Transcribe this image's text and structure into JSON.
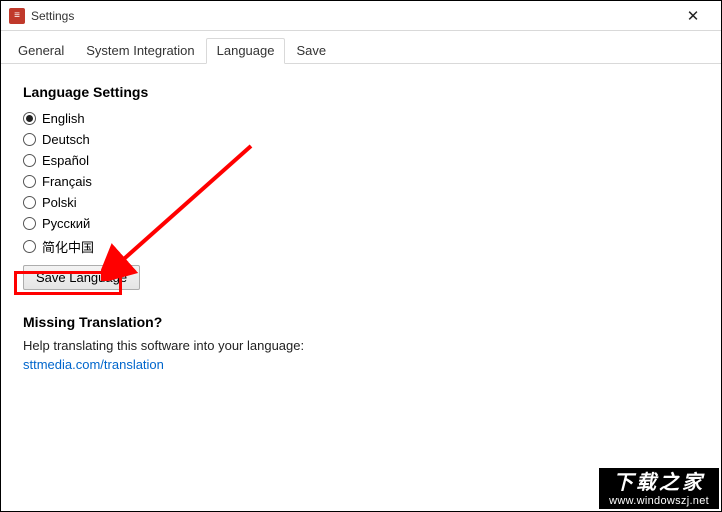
{
  "window": {
    "title": "Settings"
  },
  "tabs": {
    "items": [
      "General",
      "System Integration",
      "Language",
      "Save"
    ],
    "activeIndex": 2
  },
  "languageSection": {
    "heading": "Language Settings",
    "options": [
      "English",
      "Deutsch",
      "Español",
      "Français",
      "Polski",
      "Русский",
      "简化中国"
    ],
    "selectedIndex": 0,
    "saveButton": "Save Language"
  },
  "missingSection": {
    "heading": "Missing Translation?",
    "helpText": "Help translating this software into your language:",
    "linkText": "sttmedia.com/translation"
  },
  "watermark": {
    "line1": "下载之家",
    "line2": "www.windowszj.net"
  }
}
